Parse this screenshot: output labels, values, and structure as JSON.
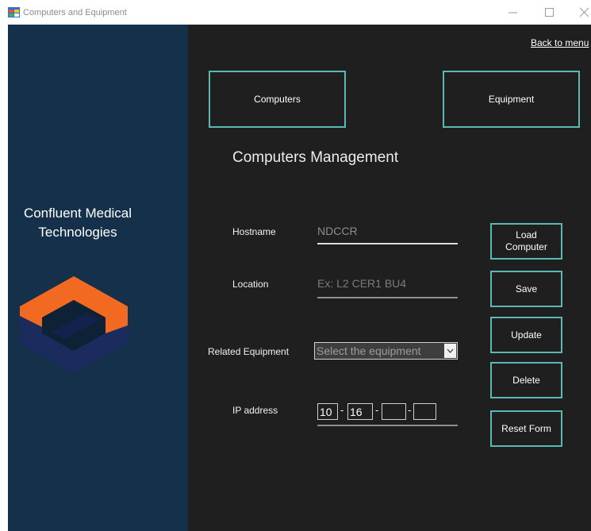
{
  "window": {
    "title": "Computers and Equipment",
    "app_icon": "app-icon",
    "controls": [
      "minimize-icon",
      "maximize-icon",
      "close-icon"
    ]
  },
  "theme": {
    "sidebar_bg": "#15304a",
    "main_bg": "#1f1f1f",
    "accent": "#5ab9b4",
    "logo_orange": "#f26a22",
    "logo_navy": "#1c2b5e"
  },
  "sidebar": {
    "company_name_line1": "Confluent Medical",
    "company_name_line2": "Technologies",
    "logo": "company-logo"
  },
  "nav": {
    "back_link": "Back to menu",
    "computers": "Computers",
    "equipment": "Equipment"
  },
  "form": {
    "heading": "Computers Management",
    "hostname": {
      "label": "Hostname",
      "value": "NDCCR"
    },
    "location": {
      "label": "Location",
      "value": "",
      "placeholder": "Ex: L2 CER1 BU4"
    },
    "related_equipment": {
      "label": "Related Equipment",
      "selected": "Select the equipment",
      "icon": "chevron-down-icon"
    },
    "ip_address": {
      "label": "IP address",
      "octets": [
        "10",
        "16",
        "",
        ""
      ],
      "separator": "-"
    }
  },
  "actions": {
    "load": "Load Computer",
    "save": "Save",
    "update": "Update",
    "delete": "Delete",
    "reset": "Reset Form"
  }
}
